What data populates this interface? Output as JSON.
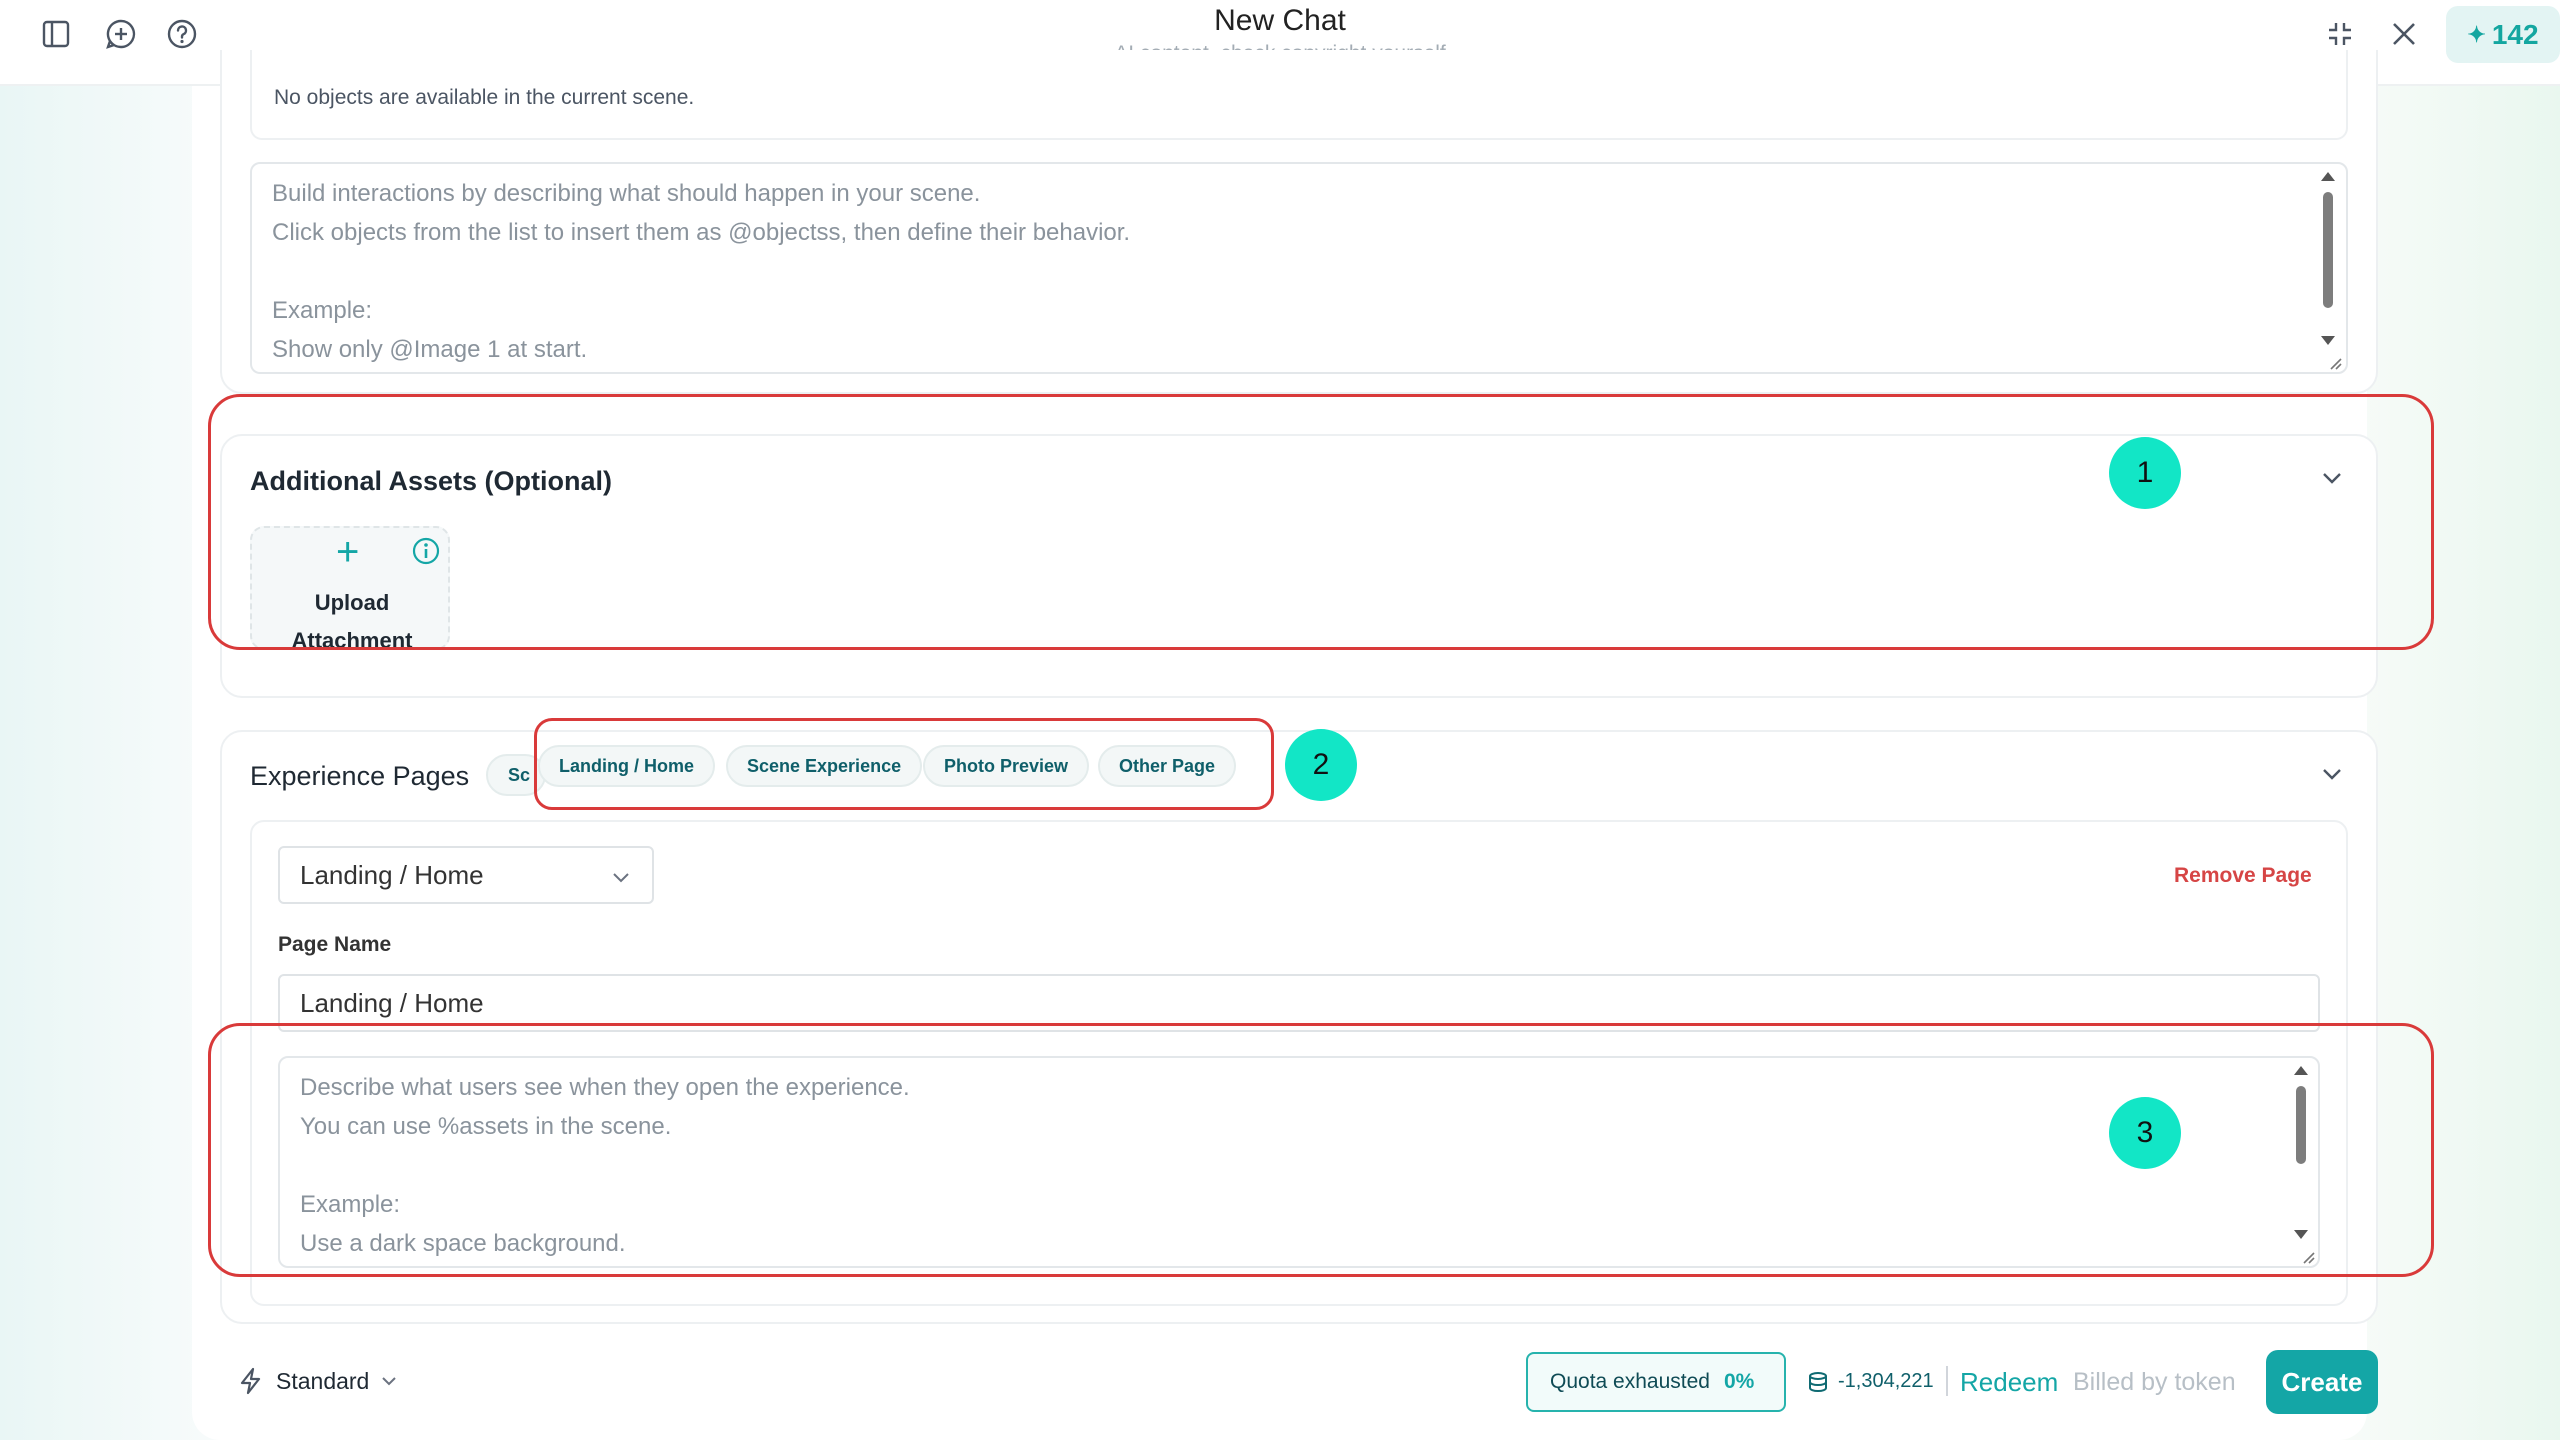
{
  "header": {
    "title": "New Chat",
    "subtitle": "AI content, check copyright yourself",
    "credits": "142"
  },
  "interactions": {
    "no_objects_text": "No objects are available in the current scene.",
    "placeholder_lines": [
      "Build interactions by describing what should happen in your scene.",
      "Click objects from the list to insert them as @objectss, then define their behavior.",
      "",
      "Example:",
      "Show only @Image 1 at start."
    ]
  },
  "assets": {
    "title": "Additional Assets (Optional)",
    "upload_label_1": "Upload",
    "upload_label_2": "Attachment"
  },
  "pages": {
    "title": "Experience Pages",
    "chip_partial": "Sc",
    "chips": [
      "Landing / Home",
      "Scene Experience",
      "Photo Preview",
      "Other Page"
    ],
    "selected_page": "Landing / Home",
    "remove_label": "Remove Page",
    "page_name_label": "Page Name",
    "page_name_value": "Landing / Home",
    "desc_placeholder_lines": [
      "Describe what users see when they open the experience.",
      "You can use %assets in the scene.",
      "",
      "Example:",
      "Use a dark space background."
    ]
  },
  "annotations": {
    "badge_1": "1",
    "badge_2": "2",
    "badge_3": "3"
  },
  "footer": {
    "mode": "Standard",
    "quota_label": "Quota exhausted",
    "quota_percent": "0%",
    "token_balance": "-1,304,221",
    "redeem": "Redeem",
    "billed": "Billed by token",
    "create": "Create"
  },
  "colors": {
    "accent": "#14a6a6",
    "annotation_red": "#d93a3a",
    "badge": "#12e6c6",
    "danger_text": "#d64545"
  }
}
